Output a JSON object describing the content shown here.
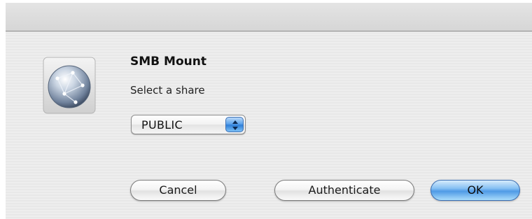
{
  "dialog": {
    "title": "SMB Mount",
    "message": "Select a share",
    "share_select": {
      "selected": "PUBLIC"
    },
    "buttons": {
      "cancel_label": "Cancel",
      "authenticate_label": "Authenticate",
      "ok_label": "OK"
    },
    "icon": "network-globe-icon",
    "colors": {
      "default_button": "#5da3ec",
      "window_bg": "#ededed"
    }
  }
}
